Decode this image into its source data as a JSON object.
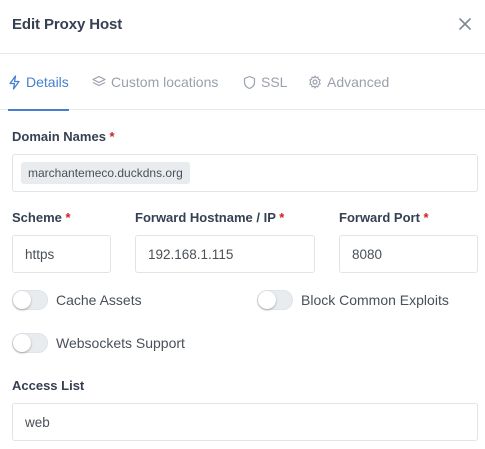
{
  "modal": {
    "title": "Edit Proxy Host"
  },
  "tabs": [
    {
      "label": "Details",
      "icon": "bolt-icon",
      "active": true
    },
    {
      "label": "Custom locations",
      "icon": "layers-icon",
      "active": false
    },
    {
      "label": "SSL",
      "icon": "shield-icon",
      "active": false
    },
    {
      "label": "Advanced",
      "icon": "gear-icon",
      "active": false
    }
  ],
  "form": {
    "domain_names": {
      "label": "Domain Names",
      "required_mark": "*",
      "values": [
        "marchantemeco.duckdns.org"
      ]
    },
    "scheme": {
      "label": "Scheme",
      "required_mark": "*",
      "value": "https"
    },
    "forward_hostname": {
      "label": "Forward Hostname / IP",
      "required_mark": "*",
      "value": "192.168.1.115"
    },
    "forward_port": {
      "label": "Forward Port",
      "required_mark": "*",
      "value": "8080"
    },
    "toggles": {
      "cache_assets": {
        "label": "Cache Assets",
        "on": false
      },
      "block_exploits": {
        "label": "Block Common Exploits",
        "on": false
      },
      "websockets": {
        "label": "Websockets Support",
        "on": false
      }
    },
    "access_list": {
      "label": "Access List",
      "value": "web"
    }
  },
  "colors": {
    "accent": "#467fcf",
    "required": "#cd201f",
    "muted": "#9aa0ac",
    "border": "#dfe3ea"
  }
}
